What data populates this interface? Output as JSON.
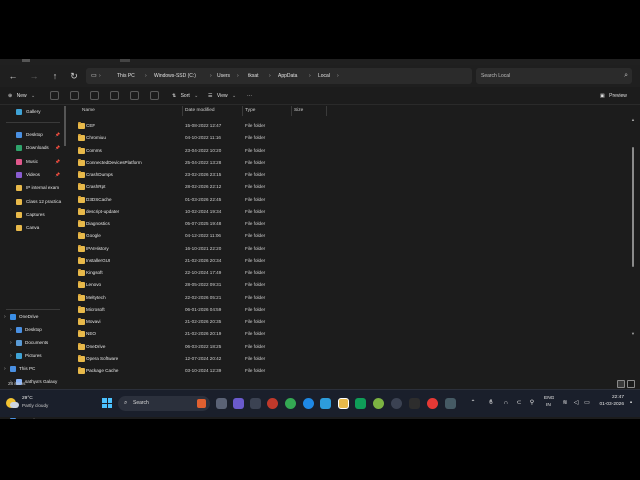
{
  "address": {
    "breadcrumb": [
      "This PC",
      "Windows-SSD (C:)",
      "Users",
      "tksat",
      "AppData",
      "Local"
    ],
    "search_placeholder": "Search Local"
  },
  "toolbar": {
    "new_label": "New",
    "sort_label": "Sort",
    "view_label": "View",
    "more_label": "···",
    "preview_label": "Preview"
  },
  "sidebar": {
    "gallery": "Gallery",
    "quick": [
      {
        "label": "Desktop",
        "icon": "desktop-icon",
        "color": "#4a90e2"
      },
      {
        "label": "Downloads",
        "icon": "download-icon",
        "color": "#2fa36b"
      },
      {
        "label": "Music",
        "icon": "music-icon",
        "color": "#e0588b"
      },
      {
        "label": "Videos",
        "icon": "video-icon",
        "color": "#8a5cd0"
      },
      {
        "label": "IP internal exam",
        "icon": "folder-icon",
        "color": "#e8b94a"
      },
      {
        "label": "Class 12 practica",
        "icon": "folder-icon",
        "color": "#e8b94a"
      },
      {
        "label": "Captures",
        "icon": "folder-icon",
        "color": "#e8b94a"
      },
      {
        "label": "Canva",
        "icon": "folder-icon",
        "color": "#e8b94a"
      }
    ],
    "tree": [
      {
        "label": "OneDrive",
        "icon": "cloud-icon",
        "color": "#3a8ee6"
      },
      {
        "label": "Desktop",
        "icon": "desktop-icon",
        "color": "#4a90e2"
      },
      {
        "label": "Documents",
        "icon": "document-icon",
        "color": "#5a9bd6"
      },
      {
        "label": "Pictures",
        "icon": "picture-icon",
        "color": "#3fa3d6"
      },
      {
        "label": "This PC",
        "icon": "computer-icon",
        "color": "#4a90e2"
      },
      {
        "label": "sathya's Galaxy",
        "icon": "phone-icon",
        "color": "#8ab4f8"
      },
      {
        "label": "Internal stora",
        "icon": "drive-icon",
        "color": "#9aa0a6"
      },
      {
        "label": "Windows-SSD",
        "icon": "drive-icon",
        "color": "#9aa0a6"
      },
      {
        "label": "Network",
        "icon": "network-icon",
        "color": "#4a90e2"
      }
    ]
  },
  "columns": {
    "name": "Name",
    "date": "Date modified",
    "type": "Type",
    "size": "Size"
  },
  "files": [
    {
      "name": "CEF",
      "date": "15-08-2022 12:47",
      "type": "File folder"
    },
    {
      "name": "Chromiuu",
      "date": "04-10-2022 11:16",
      "type": "File folder"
    },
    {
      "name": "Comms",
      "date": "23-04-2022 10:20",
      "type": "File folder"
    },
    {
      "name": "ConnectedDevicesPlatform",
      "date": "25-04-2022 13:28",
      "type": "File folder"
    },
    {
      "name": "CrashDumps",
      "date": "23-02-2026 23:15",
      "type": "File folder"
    },
    {
      "name": "CrashRpt",
      "date": "28-02-2026 22:12",
      "type": "File folder"
    },
    {
      "name": "D3DSCache",
      "date": "01-03-2026 22:45",
      "type": "File folder"
    },
    {
      "name": "descript-updater",
      "date": "10-02-2024 19:34",
      "type": "File folder"
    },
    {
      "name": "Diagnostics",
      "date": "05-07-2025 19:48",
      "type": "File folder"
    },
    {
      "name": "Google",
      "date": "04-12-2022 11:06",
      "type": "File folder"
    },
    {
      "name": "IPAIHistory",
      "date": "16-10-2021 22:20",
      "type": "File folder"
    },
    {
      "name": "InstallerGUI",
      "date": "21-02-2026 20:34",
      "type": "File folder"
    },
    {
      "name": "Kingsoft",
      "date": "22-10-2024 17:49",
      "type": "File folder"
    },
    {
      "name": "Lenovo",
      "date": "28-05-2022 09:31",
      "type": "File folder"
    },
    {
      "name": "Meltytech",
      "date": "22-02-2026 05:21",
      "type": "File folder"
    },
    {
      "name": "Microsoft",
      "date": "06-01-2026 04:59",
      "type": "File folder"
    },
    {
      "name": "Movavi",
      "date": "21-02-2026 20:35",
      "type": "File folder"
    },
    {
      "name": "NEO",
      "date": "21-02-2026 20:19",
      "type": "File folder"
    },
    {
      "name": "OneDrive",
      "date": "06-03-2022 18:25",
      "type": "File folder"
    },
    {
      "name": "Opera Software",
      "date": "12-07-2024 20:42",
      "type": "File folder"
    },
    {
      "name": "Package Cache",
      "date": "03-10-2024 12:39",
      "type": "File folder"
    }
  ],
  "status": {
    "count": "28 items"
  },
  "taskbar": {
    "temp": "29°C",
    "weather": "Partly cloudy",
    "search_label": "Search",
    "lang": "ENG",
    "region": "IN",
    "time": "22:47",
    "date": "01-03-2026"
  },
  "colors": {
    "accent": "#4cc2ff",
    "folder": "#e8b94a",
    "background": "#1c1c1c"
  }
}
